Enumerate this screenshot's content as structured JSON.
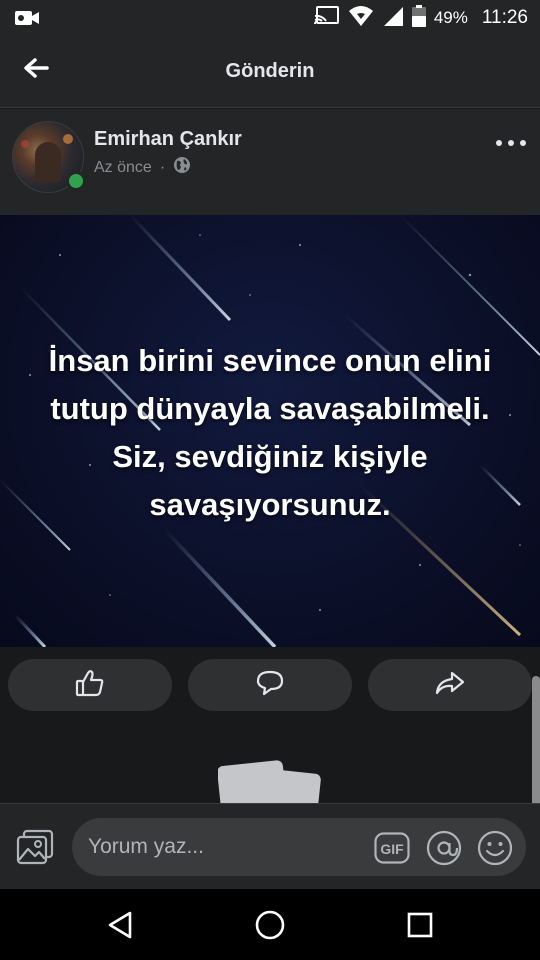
{
  "status_bar": {
    "battery_percent": "49%",
    "time": "11:26",
    "icons": [
      "video-camera-icon",
      "cast-icon",
      "wifi-icon",
      "cell-signal-icon",
      "battery-icon"
    ]
  },
  "header": {
    "title": "Gönderin",
    "back_icon": "arrow-left-icon"
  },
  "post": {
    "author": "Emirhan Çankır",
    "timestamp": "Az önce",
    "separator": "·",
    "privacy_icon": "globe-icon",
    "online": true,
    "more_icon": "more-horizontal-icon",
    "image_text": "İnsan birini sevince onun elini tutup dünyayla savaşabilmeli. Siz, sevdiğiniz kişiyle savaşıyorsunuz."
  },
  "actions": [
    {
      "name": "like",
      "icon": "thumbs-up-icon"
    },
    {
      "name": "comment",
      "icon": "comment-bubble-icon"
    },
    {
      "name": "share",
      "icon": "share-arrow-icon"
    }
  ],
  "composer": {
    "placeholder": "Yorum yaz...",
    "value": "",
    "gif_label": "GIF",
    "icons": [
      "photo-gallery-icon",
      "gif-icon",
      "at-mention-icon",
      "emoji-icon"
    ]
  },
  "nav_bar": {
    "icons": [
      "nav-back-icon",
      "nav-home-icon",
      "nav-recents-icon"
    ]
  },
  "colors": {
    "background": "#18191a",
    "surface": "#242526",
    "button": "#2f3031",
    "input": "#3a3b3c",
    "online_green": "#31a24c",
    "text_primary": "#e4e6eb",
    "text_secondary": "#8a8d91"
  }
}
